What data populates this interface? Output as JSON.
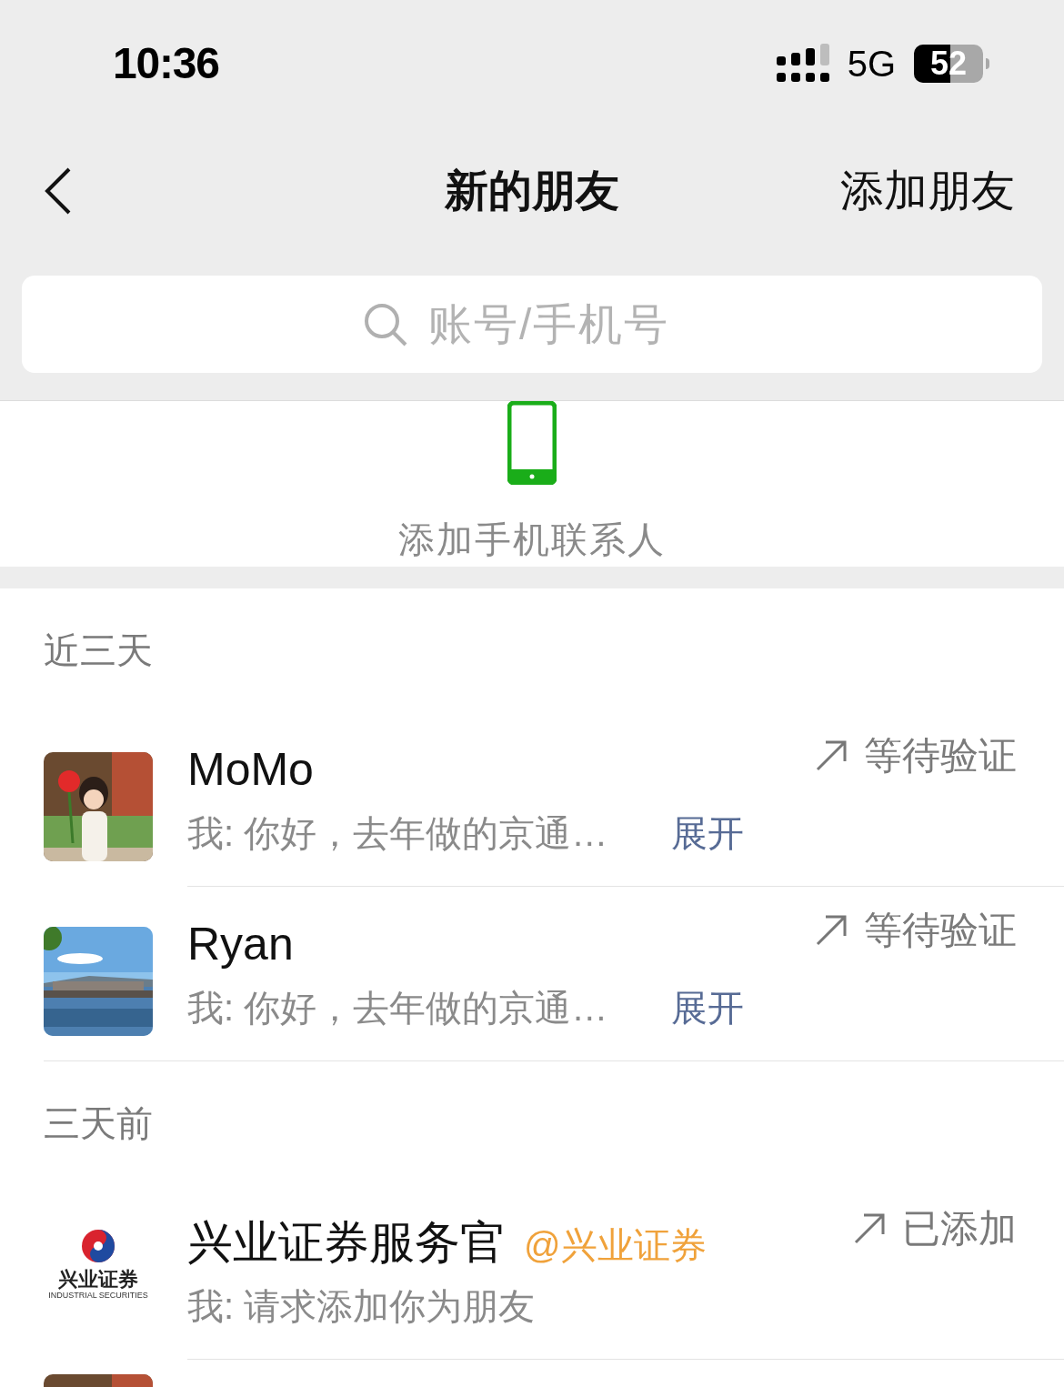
{
  "status_bar": {
    "time": "10:36",
    "network": "5G",
    "battery": "52"
  },
  "nav": {
    "title": "新的朋友",
    "action": "添加朋友"
  },
  "search": {
    "placeholder": "账号/手机号"
  },
  "add_contacts": {
    "label": "添加手机联系人"
  },
  "sections": [
    {
      "title": "近三天",
      "items": [
        {
          "avatar": {
            "kind": "picture"
          },
          "name": "MoMo",
          "message": "我: 你好，去年做的京通…",
          "expand": "展开",
          "status": "等待验证"
        },
        {
          "avatar": {
            "kind": "picture"
          },
          "name": "Ryan",
          "message": "我: 你好，去年做的京通…",
          "expand": "展开",
          "status": "等待验证"
        }
      ]
    },
    {
      "title": "三天前",
      "items": [
        {
          "avatar": {
            "kind": "logo",
            "text": "兴业证券",
            "subtext": "INDUSTRIAL SECURITIES"
          },
          "name": "兴业证券服务官",
          "tag": "@兴业证券",
          "message": "我: 请求添加你为朋友",
          "status": "已添加"
        },
        {
          "avatar": {
            "kind": "picture"
          }
        }
      ]
    }
  ]
}
